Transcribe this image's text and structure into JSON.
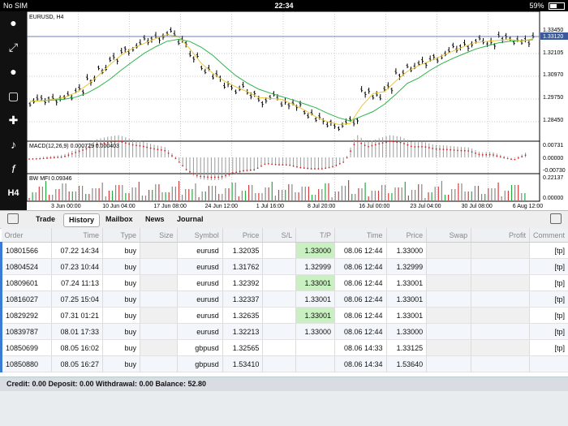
{
  "status_bar": {
    "carrier": "No SIM",
    "time": "22:34",
    "battery": "59%",
    "battery_level": 0.59
  },
  "sidebar": {
    "items": [
      {
        "icon": "user-icon",
        "label": ""
      },
      {
        "icon": "expand-arrows-icon",
        "label": ""
      },
      {
        "icon": "chat-icon",
        "label": ""
      },
      {
        "icon": "new-order-icon",
        "label": ""
      },
      {
        "icon": "crosshair-icon",
        "label": ""
      },
      {
        "icon": "indicator-icon",
        "label": ""
      },
      {
        "icon": "function-icon",
        "label": "f"
      },
      {
        "icon": "timeframe-icon",
        "label": "H4"
      }
    ]
  },
  "chart_data": [
    {
      "type": "line",
      "title": "EURUSD, H4",
      "ylim": [
        1.28,
        1.34
      ],
      "yticks": [
        "1.33450",
        "1.33120",
        "1.32105",
        "1.30970",
        "1.29750",
        "1.28450"
      ],
      "current_price": "1.33120",
      "xticks": [
        "3 Jun 00:00",
        "10 Jun 04:00",
        "17 Jun 08:00",
        "24 Jun 12:00",
        "1 Jul 16:00",
        "8 Jul 20:00",
        "16 Jul 00:00",
        "23 Jul 04:00",
        "30 Jul 08:00",
        "6 Aug 12:00"
      ],
      "series": [
        {
          "values": [
            1.2985,
            1.299,
            1.3,
            1.301,
            1.305,
            1.309,
            1.315,
            1.32,
            1.325,
            1.327,
            1.33,
            1.332,
            1.334,
            1.33,
            1.321,
            1.315,
            1.311,
            1.307,
            1.305,
            1.302,
            1.299,
            1.301,
            1.298,
            1.296,
            1.292,
            1.289,
            1.287,
            1.286,
            1.288,
            1.304,
            1.301,
            1.306,
            1.312,
            1.316,
            1.318,
            1.321,
            1.323,
            1.326,
            1.328,
            1.33,
            1.329,
            1.331,
            1.33,
            1.329,
            1.333
          ]
        }
      ]
    },
    {
      "type": "bar",
      "title": "MACD(12,26,9) 0.000729 0.000403",
      "yticks": [
        "0.00731",
        "0.00000",
        "-0.00730"
      ]
    },
    {
      "type": "bar",
      "title": "BW MFI 0.09346",
      "yticks": [
        "0.22137",
        "0.00000"
      ]
    }
  ],
  "tabs": [
    {
      "label": "Trade"
    },
    {
      "label": "History",
      "active": true
    },
    {
      "label": "Mailbox"
    },
    {
      "label": "News"
    },
    {
      "label": "Journal"
    }
  ],
  "table": {
    "columns": [
      "Order",
      "Time",
      "Type",
      "Size",
      "Symbol",
      "Price",
      "S/L",
      "T/P",
      "Time",
      "Price",
      "Swap",
      "Profit",
      "Comment"
    ],
    "rows": [
      [
        "10801566",
        "07.22 14:34",
        "buy",
        "",
        "eurusd",
        "1.32035",
        "",
        "1.33000",
        "08.06 12:44",
        "1.33000",
        "",
        "",
        "[tp]"
      ],
      [
        "10804524",
        "07.23 10:44",
        "buy",
        "",
        "eurusd",
        "1.31762",
        "",
        "1.32999",
        "08.06 12:44",
        "1.32999",
        "",
        "",
        "[tp]"
      ],
      [
        "10809601",
        "07.24 11:13",
        "buy",
        "",
        "eurusd",
        "1.32392",
        "",
        "1.33001",
        "08.06 12:44",
        "1.33001",
        "",
        "",
        "[tp]"
      ],
      [
        "10816027",
        "07.25 15:04",
        "buy",
        "",
        "eurusd",
        "1.32337",
        "",
        "1.33001",
        "08.06 12:44",
        "1.33001",
        "",
        "",
        "[tp]"
      ],
      [
        "10829292",
        "07.31 01:21",
        "buy",
        "",
        "eurusd",
        "1.32635",
        "",
        "1.33001",
        "08.06 12:44",
        "1.33001",
        "",
        "",
        "[tp]"
      ],
      [
        "10839787",
        "08.01 17:33",
        "buy",
        "",
        "eurusd",
        "1.32213",
        "",
        "1.33000",
        "08.06 12:44",
        "1.33000",
        "",
        "",
        "[tp]"
      ],
      [
        "10850699",
        "08.05 16:02",
        "buy",
        "",
        "gbpusd",
        "1.32565",
        "",
        "",
        "08.06 14:33",
        "1.33125",
        "",
        "",
        "[tp]"
      ],
      [
        "10850880",
        "08.05 16:27",
        "buy",
        "",
        "gbpusd",
        "1.53410",
        "",
        "",
        "08.06 14:34",
        "1.53640",
        "",
        "",
        ""
      ]
    ]
  },
  "footer": {
    "summary": "Credit: 0.00 Deposit: 0.00 Withdrawal: 0.00 Balance: 52.80"
  },
  "colors": {
    "accent": "#3a7bd5",
    "tp_fill": "#c9f0c0",
    "ma_green": "#2db34a",
    "ma_yellow": "#e8c83a",
    "macd_signal": "#cc1f1f",
    "volume_green": "#27a844",
    "volume_red": "#d63a3a"
  }
}
